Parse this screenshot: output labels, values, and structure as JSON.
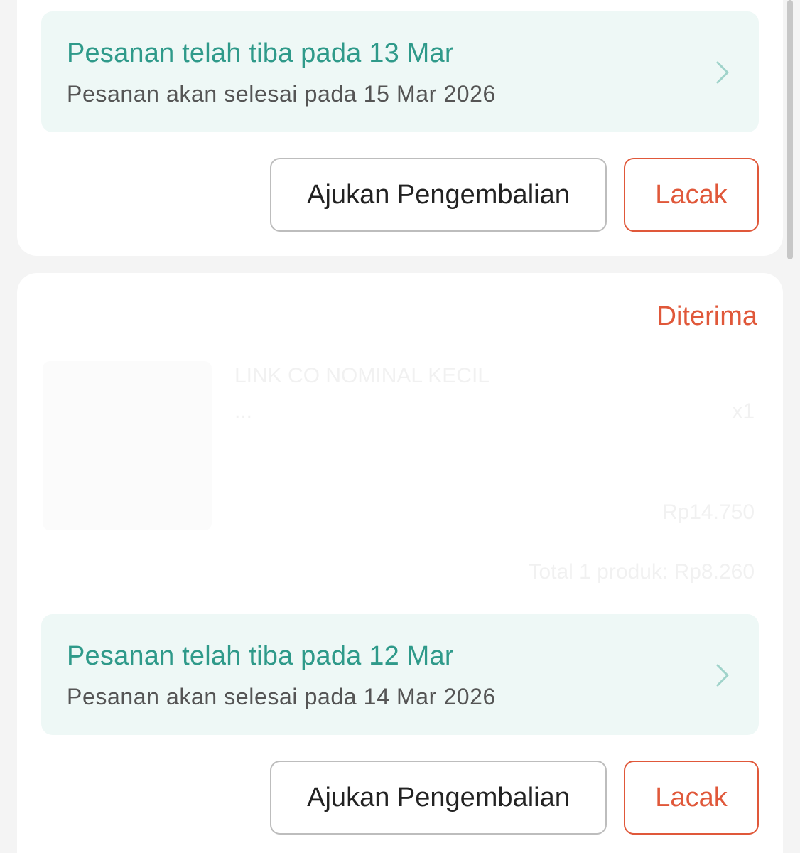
{
  "orders": [
    {
      "delivery": {
        "title": "Pesanan telah tiba pada 13 Mar",
        "subtitle": "Pesanan akan selesai pada 15 Mar 2026"
      },
      "buttons": {
        "return_label": "Ajukan Pengembalian",
        "track_label": "Lacak"
      }
    },
    {
      "status": "Diterima",
      "product": {
        "name": "LINK CO NOMINAL KECIL",
        "variant": "...",
        "quantity": "x1",
        "price": "Rp14.750"
      },
      "total": "Total 1 produk: Rp8.260",
      "delivery": {
        "title": "Pesanan telah tiba pada 12 Mar",
        "subtitle": "Pesanan akan selesai pada 14 Mar 2026"
      },
      "buttons": {
        "return_label": "Ajukan Pengembalian",
        "track_label": "Lacak"
      }
    }
  ],
  "colors": {
    "accent_teal": "#2f9a8a",
    "accent_orange": "#e0583a",
    "delivery_bg": "#eef8f6"
  },
  "icons": {
    "chevron": "chevron-right-icon"
  }
}
